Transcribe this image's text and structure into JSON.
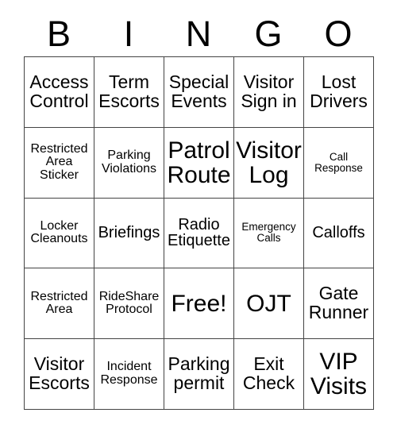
{
  "card": {
    "header_letters": [
      "B",
      "I",
      "N",
      "G",
      "O"
    ],
    "columns": 5,
    "rows": 5,
    "border_color": "#444444",
    "background_color": "#ffffff",
    "text_color": "#000000",
    "free_space_label": "Free!",
    "free_space_position": "center",
    "cells": [
      [
        {
          "text": "Access Control",
          "size": "lg"
        },
        {
          "text": "Term Escorts",
          "size": "lg"
        },
        {
          "text": "Special Events",
          "size": "lg"
        },
        {
          "text": "Visitor Sign in",
          "size": "lg"
        },
        {
          "text": "Lost Drivers",
          "size": "lg"
        }
      ],
      [
        {
          "text": "Restricted Area Sticker",
          "size": "sm"
        },
        {
          "text": "Parking Violations",
          "size": "sm"
        },
        {
          "text": "Patrol Route",
          "size": "xl"
        },
        {
          "text": "Visitor Log",
          "size": "xl"
        },
        {
          "text": "Call Response",
          "size": "xs"
        }
      ],
      [
        {
          "text": "Locker Cleanouts",
          "size": "sm"
        },
        {
          "text": "Briefings",
          "size": "md"
        },
        {
          "text": "Radio Etiquette",
          "size": "md"
        },
        {
          "text": "Emergency Calls",
          "size": "xs"
        },
        {
          "text": "Calloffs",
          "size": "md"
        }
      ],
      [
        {
          "text": "Restricted Area",
          "size": "sm"
        },
        {
          "text": "RideShare Protocol",
          "size": "sm"
        },
        {
          "text": "Free!",
          "size": "xl"
        },
        {
          "text": "OJT",
          "size": "xl"
        },
        {
          "text": "Gate Runner",
          "size": "lg"
        }
      ],
      [
        {
          "text": "Visitor Escorts",
          "size": "lg"
        },
        {
          "text": "Incident Response",
          "size": "sm"
        },
        {
          "text": "Parking permit",
          "size": "lg"
        },
        {
          "text": "Exit Check",
          "size": "lg"
        },
        {
          "text": "VIP Visits",
          "size": "xl"
        }
      ]
    ]
  }
}
